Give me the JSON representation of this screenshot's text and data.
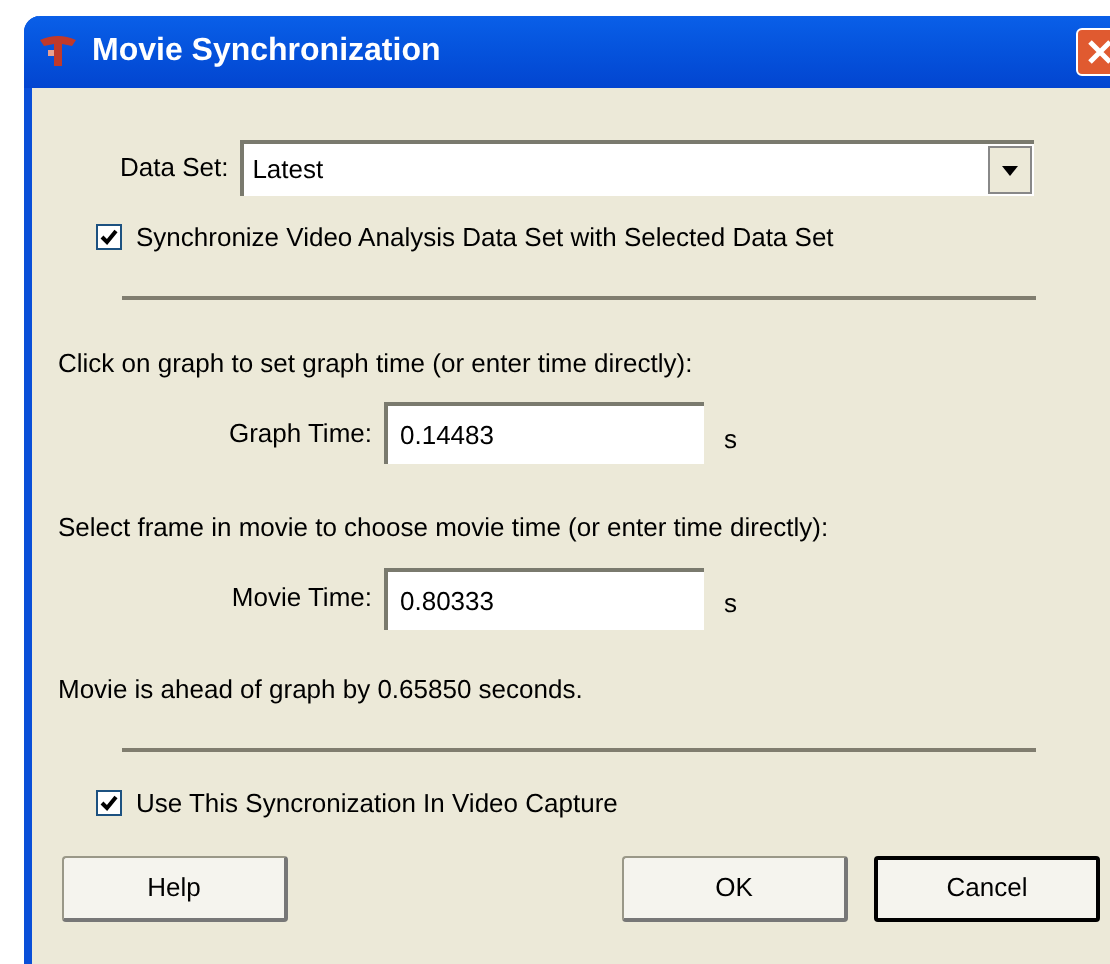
{
  "window": {
    "title": "Movie Synchronization"
  },
  "data_set": {
    "label": "Data Set:",
    "value": "Latest"
  },
  "sync_checkbox": {
    "label": "Synchronize Video Analysis Data Set with Selected Data Set",
    "checked": true
  },
  "graph_instruction": "Click on graph to set graph time (or enter time directly):",
  "graph_time": {
    "label": "Graph Time:",
    "value": "0.14483",
    "unit": "s"
  },
  "movie_instruction": "Select frame in movie to choose movie time (or enter time directly):",
  "movie_time": {
    "label": "Movie Time:",
    "value": "0.80333",
    "unit": "s"
  },
  "offset_message": "Movie is ahead of graph by 0.65850 seconds.",
  "capture_checkbox": {
    "label": "Use This Syncronization In Video Capture",
    "checked": true
  },
  "buttons": [
    {
      "label": "Help",
      "default": false
    },
    {
      "label": "OK",
      "default": false
    },
    {
      "label": "Cancel",
      "default": true
    }
  ]
}
